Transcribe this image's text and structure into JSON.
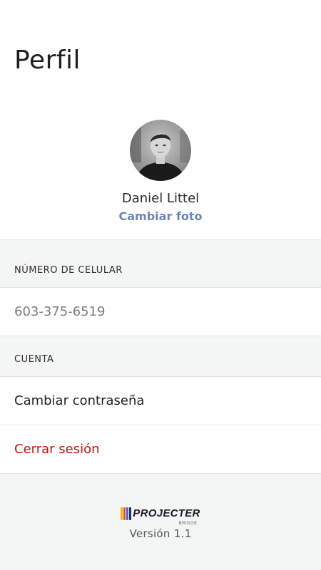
{
  "header": {
    "title": "Perfil"
  },
  "profile": {
    "name": "Daniel Littel",
    "change_photo_label": "Cambiar foto"
  },
  "phone_section": {
    "header": "NÚMERO DE CELULAR",
    "value": "603-375-6519"
  },
  "account_section": {
    "header": "CUENTA",
    "change_password_label": "Cambiar contraseña",
    "logout_label": "Cerrar sesión"
  },
  "footer": {
    "logo_text": "PROJECTER",
    "logo_subtext": "BRIDGE",
    "version": "Versión 1.1"
  },
  "colors": {
    "accent_link": "#6d86b8",
    "danger": "#cc1111",
    "background": "#f4f5f5",
    "logo_bars": [
      "#f2b705",
      "#e84c3d",
      "#3b6fd4",
      "#2a2a5a"
    ]
  }
}
